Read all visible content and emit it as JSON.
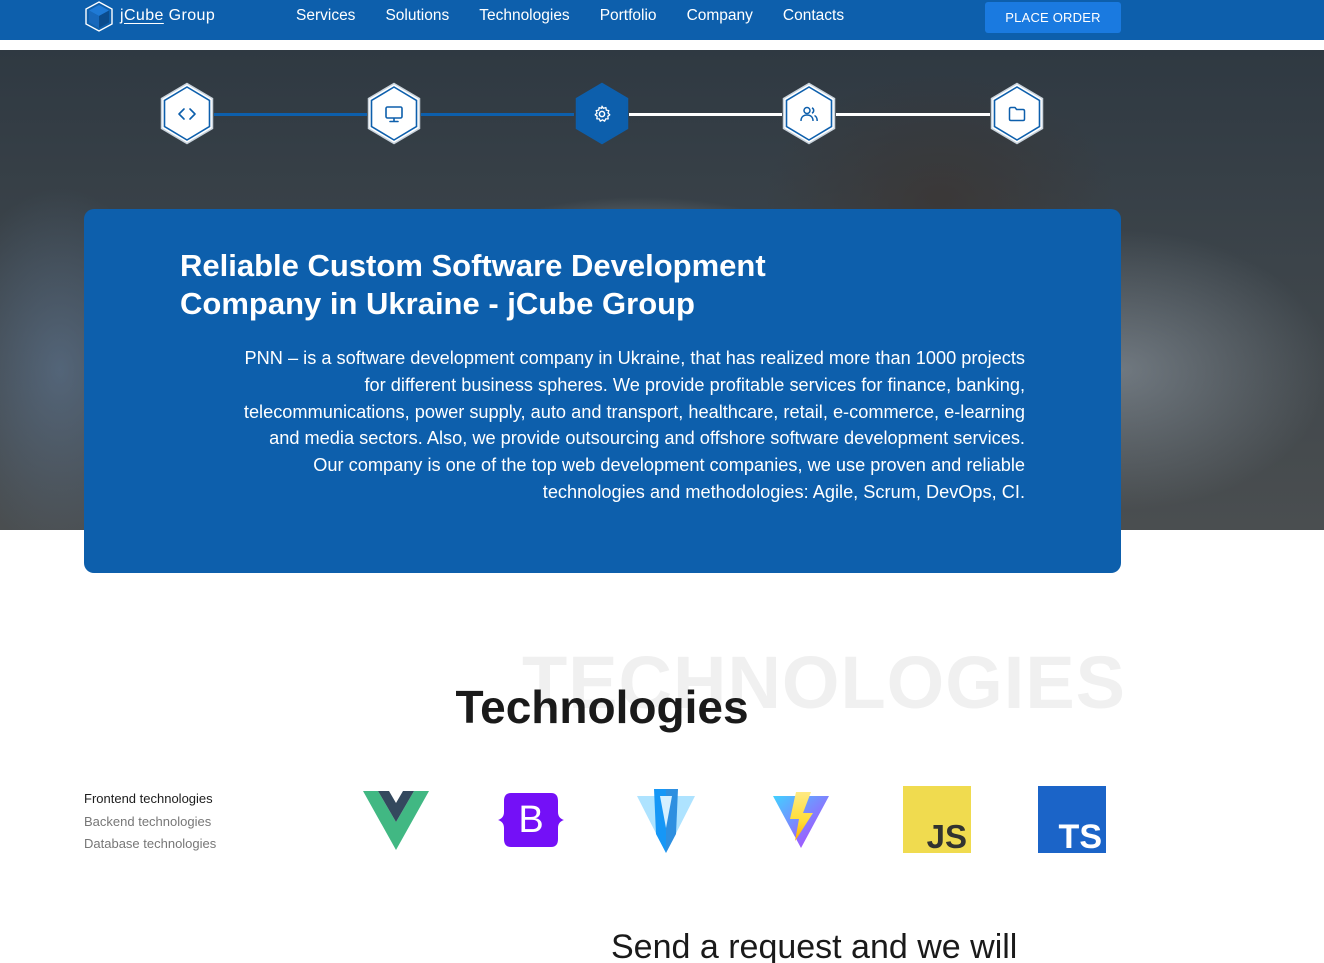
{
  "header": {
    "logo_text_prefix": "j",
    "logo_text_cube": "Cube",
    "logo_text_suffix": " Group",
    "nav": [
      "Services",
      "Solutions",
      "Technologies",
      "Portfolio",
      "Company",
      "Contacts"
    ],
    "order_button": "PLACE ORDER"
  },
  "hero": {
    "steps": [
      {
        "icon": "code-icon",
        "active": false
      },
      {
        "icon": "monitor-icon",
        "active": false
      },
      {
        "icon": "gear-icon",
        "active": true
      },
      {
        "icon": "users-icon",
        "active": false
      },
      {
        "icon": "folder-icon",
        "active": false
      }
    ],
    "title_line1": "Reliable Custom Software Development",
    "title_line2": "Company in Ukraine - jCube Group",
    "description": "PNN – is a software development company in Ukraine, that has realized more than 1000 projects for different business spheres. We provide profitable services for finance, banking, telecommunications, power supply, auto and transport, healthcare, retail, e-commerce, e-learning and media sectors. Also, we provide outsourcing and offshore software development services. Our company is one of the top web development companies, we use proven and reliable technologies and methodologies: Agile, Scrum, DevOps, CI."
  },
  "technologies": {
    "background_word": "TECHNOLOGIES",
    "title": "Technologies",
    "tabs": [
      "Frontend technologies",
      "Backend technologies",
      "Database technologies"
    ],
    "active_tab": "Frontend technologies",
    "logos": [
      {
        "icon": "vue-logo-icon",
        "text": ""
      },
      {
        "icon": "bootstrap-logo-icon",
        "text": "B"
      },
      {
        "icon": "vuetify-logo-icon",
        "text": ""
      },
      {
        "icon": "vite-logo-icon",
        "text": ""
      },
      {
        "icon": "javascript-logo-icon",
        "text": "JS"
      },
      {
        "icon": "typescript-logo-icon",
        "text": "TS"
      }
    ]
  },
  "request": {
    "title": "Send a request and we will"
  },
  "colors": {
    "brand_blue": "#0d5fac",
    "button_blue": "#1a7ae0",
    "vue_green": "#41b883",
    "vue_dark": "#34495e",
    "bootstrap_purple": "#7410f7",
    "js_yellow": "#f0db4f",
    "ts_blue": "#1b64c8"
  }
}
